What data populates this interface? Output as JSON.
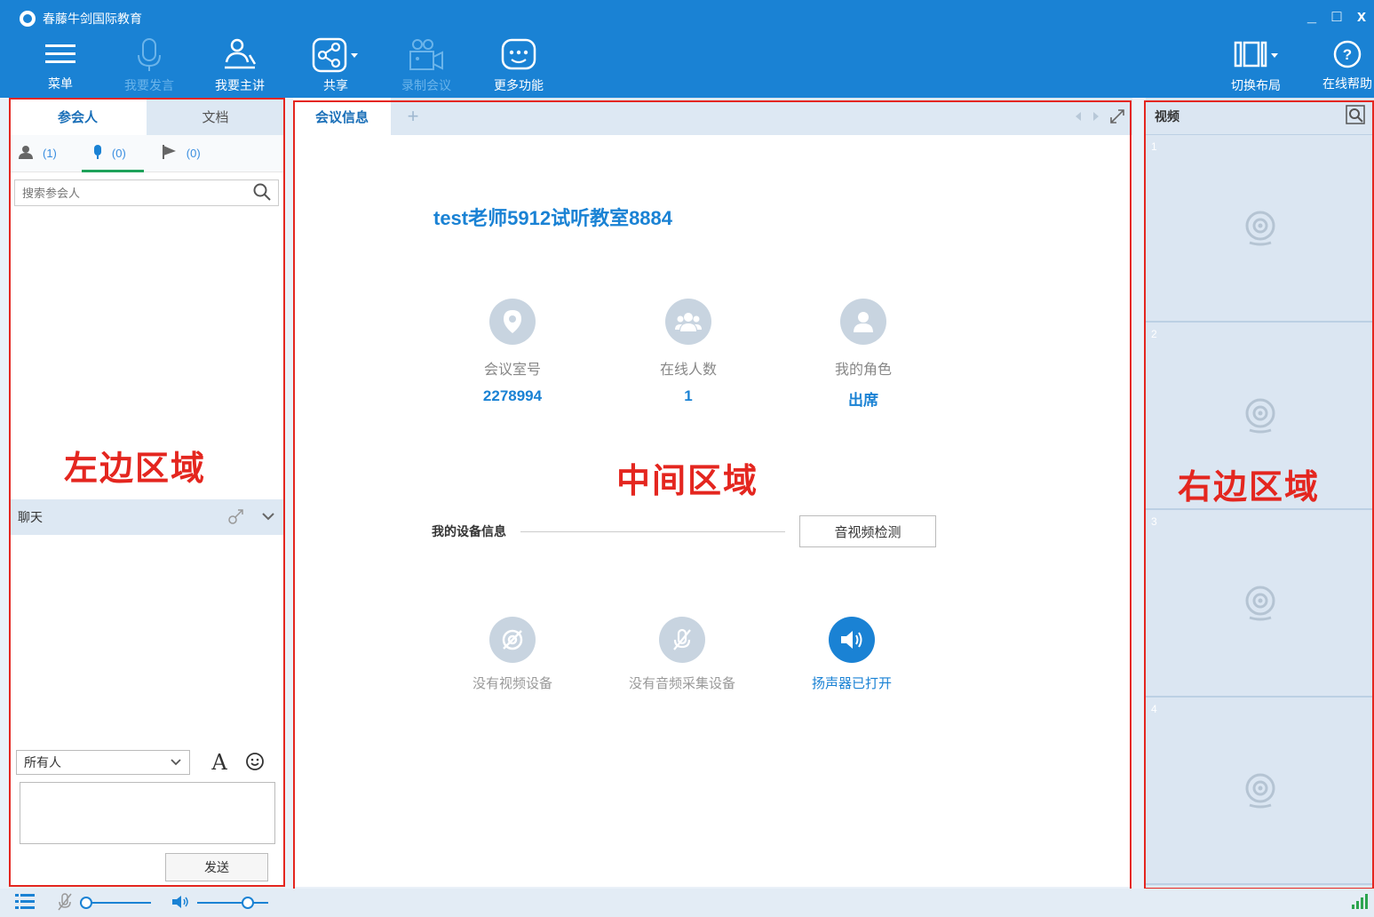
{
  "app": {
    "title": "春藤牛剑国际教育"
  },
  "window_controls": {
    "minimize": "_",
    "maximize": "□",
    "close": "x"
  },
  "toolbar": {
    "menu": "菜单",
    "speak": "我要发言",
    "present": "我要主讲",
    "share": "共享",
    "record": "录制会议",
    "more": "更多功能",
    "layout": "切换布局",
    "help": "在线帮助"
  },
  "left": {
    "tabs": [
      "参会人",
      "文档"
    ],
    "subtabs": [
      {
        "icon": "person-icon",
        "count": "(1)"
      },
      {
        "icon": "mic-icon",
        "count": "(0)"
      },
      {
        "icon": "flag-icon",
        "count": "(0)"
      }
    ],
    "search_placeholder": "搜索参会人",
    "region_label": "左边区域",
    "chat_title": "聊天",
    "chat_target": "所有人",
    "send": "发送"
  },
  "center": {
    "tab": "会议信息",
    "tab_add": "+",
    "meeting_title": "test老师5912试听教室8884",
    "info": [
      {
        "label": "会议室号",
        "value": "2278994",
        "icon": "location-pin-icon"
      },
      {
        "label": "在线人数",
        "value": "1",
        "icon": "group-icon"
      },
      {
        "label": "我的角色",
        "value": "出席",
        "icon": "user-icon"
      }
    ],
    "region_label": "中间区域",
    "device_title": "我的设备信息",
    "av_check": "音视频检测",
    "devices": [
      {
        "label": "没有视频设备",
        "icon": "camera-off-icon",
        "on": false
      },
      {
        "label": "没有音频采集设备",
        "icon": "mic-off-icon",
        "on": false
      },
      {
        "label": "扬声器已打开",
        "icon": "speaker-icon",
        "on": true
      }
    ]
  },
  "right": {
    "title": "视频",
    "region_label": "右边区域",
    "cells": [
      "1",
      "2",
      "3",
      "4"
    ]
  },
  "colors": {
    "brand": "#1a82d4",
    "outline": "#e4261f",
    "panel": "#dde8f3"
  }
}
